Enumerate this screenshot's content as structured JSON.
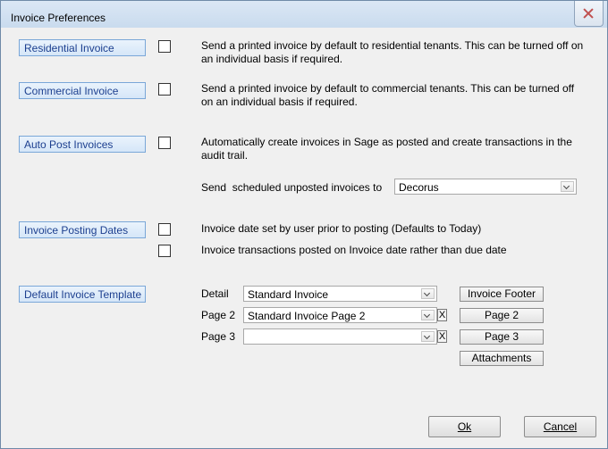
{
  "window": {
    "title": "Invoice Preferences"
  },
  "sections": {
    "residential": {
      "label": "Residential Invoice",
      "checked": false,
      "desc": "Send a printed invoice by default to residential tenants. This can be turned off on an individual basis if required."
    },
    "commercial": {
      "label": "Commercial Invoice",
      "checked": false,
      "desc": "Send a printed invoice by default to commercial tenants. This can be turned off on an individual basis if required."
    },
    "autopost": {
      "label": "Auto Post Invoices",
      "checked": false,
      "desc": "Automatically create invoices in Sage as posted and create transactions in the audit trail.",
      "send_label": "Send  scheduled unposted invoices to",
      "send_value": "Decorus"
    },
    "posting_dates": {
      "label": "Invoice Posting Dates",
      "opt1_checked": false,
      "opt1": "Invoice date set by user prior to posting (Defaults to Today)",
      "opt2_checked": false,
      "opt2": "Invoice transactions posted on Invoice date rather than due date"
    },
    "template": {
      "label": "Default Invoice Template",
      "detail_label": "Detail",
      "detail_value": "Standard Invoice",
      "page2_label": "Page 2",
      "page2_value": "Standard Invoice Page 2",
      "page3_label": "Page 3",
      "page3_value": "",
      "clear_glyph": "X",
      "footer_btn": "Invoice Footer",
      "page2_btn": "Page 2",
      "page3_btn": "Page 3",
      "attachments_btn": "Attachments"
    }
  },
  "footer": {
    "ok": "Ok",
    "cancel": "Cancel"
  },
  "icons": {
    "close": "close-icon",
    "dropdown": "chevron-down-icon"
  }
}
